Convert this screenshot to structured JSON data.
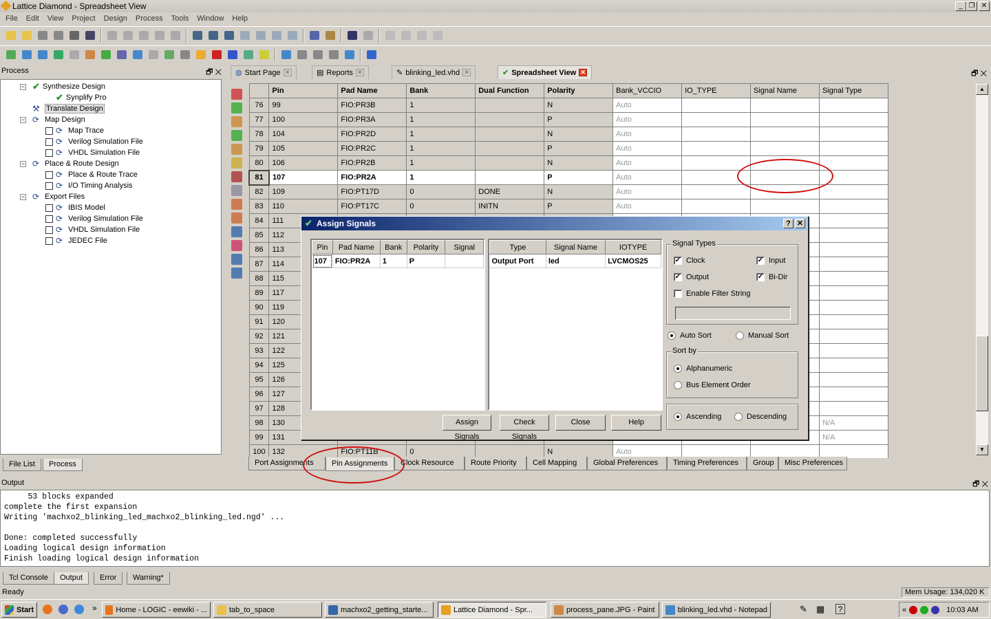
{
  "window": {
    "title": "Lattice Diamond - Spreadsheet View"
  },
  "menu": [
    "File",
    "Edit",
    "View",
    "Project",
    "Design",
    "Process",
    "Tools",
    "Window",
    "Help"
  ],
  "process_pane": {
    "title": "Process",
    "items": [
      {
        "label": "Synthesize Design",
        "level": 0,
        "icon": "check-icon",
        "expander": "minus"
      },
      {
        "label": "Synplify Pro",
        "level": 1,
        "icon": "check-icon"
      },
      {
        "label": "Translate Design",
        "level": 0,
        "icon": "hammer-icon",
        "selected": true
      },
      {
        "label": "Map Design",
        "level": 0,
        "icon": "refresh-icon",
        "expander": "minus"
      },
      {
        "label": "Map Trace",
        "level": 1,
        "icon": "refresh-icon",
        "checkbox": true
      },
      {
        "label": "Verilog Simulation File",
        "level": 1,
        "icon": "refresh-icon",
        "checkbox": true
      },
      {
        "label": "VHDL Simulation File",
        "level": 1,
        "icon": "refresh-icon",
        "checkbox": true
      },
      {
        "label": "Place & Route Design",
        "level": 0,
        "icon": "refresh-icon",
        "expander": "minus"
      },
      {
        "label": "Place & Route Trace",
        "level": 1,
        "icon": "refresh-icon",
        "checkbox": true
      },
      {
        "label": "I/O Timing Analysis",
        "level": 1,
        "icon": "refresh-icon",
        "checkbox": true
      },
      {
        "label": "Export Files",
        "level": 0,
        "icon": "refresh-icon",
        "expander": "minus"
      },
      {
        "label": "IBIS Model",
        "level": 1,
        "icon": "refresh-icon",
        "checkbox": true
      },
      {
        "label": "Verilog Simulation File",
        "level": 1,
        "icon": "refresh-icon",
        "checkbox": true
      },
      {
        "label": "VHDL Simulation File",
        "level": 1,
        "icon": "refresh-icon",
        "checkbox": true
      },
      {
        "label": "JEDEC File",
        "level": 1,
        "icon": "refresh-icon",
        "checkbox": true
      }
    ],
    "tabs": [
      "File List",
      "Process"
    ],
    "active_tab": "Process"
  },
  "editor_tabs": [
    {
      "label": "Start Page"
    },
    {
      "label": "Reports"
    },
    {
      "label": "blinking_led.vhd"
    },
    {
      "label": "Spreadsheet View",
      "active": true
    }
  ],
  "grid": {
    "columns": [
      "Pin",
      "Pad Name",
      "Bank",
      "Dual Function",
      "Polarity",
      "Bank_VCCIO",
      "IO_TYPE",
      "Signal Name",
      "Signal Type"
    ],
    "rows": [
      [
        "76",
        "99",
        "FIO:PR3B",
        "1",
        "",
        "N",
        "Auto",
        "",
        "",
        ""
      ],
      [
        "77",
        "100",
        "FIO:PR3A",
        "1",
        "",
        "P",
        "Auto",
        "",
        "",
        ""
      ],
      [
        "78",
        "104",
        "FIO:PR2D",
        "1",
        "",
        "N",
        "Auto",
        "",
        "",
        ""
      ],
      [
        "79",
        "105",
        "FIO:PR2C",
        "1",
        "",
        "P",
        "Auto",
        "",
        "",
        ""
      ],
      [
        "80",
        "106",
        "FIO:PR2B",
        "1",
        "",
        "N",
        "Auto",
        "",
        "",
        ""
      ],
      [
        "81",
        "107",
        "FIO:PR2A",
        "1",
        "",
        "P",
        "Auto",
        "",
        "",
        ""
      ],
      [
        "82",
        "109",
        "FIO:PT17D",
        "0",
        "DONE",
        "N",
        "Auto",
        "",
        "",
        ""
      ],
      [
        "83",
        "110",
        "FIO:PT17C",
        "0",
        "INITN",
        "P",
        "Auto",
        "",
        "",
        ""
      ],
      [
        "84",
        "111",
        "",
        "",
        "",
        "",
        "",
        "",
        "",
        ""
      ],
      [
        "85",
        "112",
        "",
        "",
        "",
        "",
        "",
        "",
        "",
        ""
      ],
      [
        "86",
        "113",
        "",
        "",
        "",
        "",
        "",
        "",
        "",
        ""
      ],
      [
        "87",
        "114",
        "",
        "",
        "",
        "",
        "",
        "",
        "",
        ""
      ],
      [
        "88",
        "115",
        "",
        "",
        "",
        "",
        "",
        "",
        "",
        ""
      ],
      [
        "89",
        "117",
        "",
        "",
        "",
        "",
        "",
        "",
        "",
        ""
      ],
      [
        "90",
        "119",
        "",
        "",
        "",
        "",
        "",
        "",
        "",
        ""
      ],
      [
        "91",
        "120",
        "",
        "",
        "",
        "",
        "",
        "",
        "",
        ""
      ],
      [
        "92",
        "121",
        "",
        "",
        "",
        "",
        "",
        "",
        "",
        ""
      ],
      [
        "93",
        "122",
        "",
        "",
        "",
        "",
        "",
        "",
        "",
        ""
      ],
      [
        "94",
        "125",
        "",
        "",
        "",
        "",
        "",
        "",
        "",
        ""
      ],
      [
        "95",
        "126",
        "",
        "",
        "",
        "",
        "",
        "",
        "",
        ""
      ],
      [
        "96",
        "127",
        "",
        "",
        "",
        "",
        "",
        "",
        "",
        ""
      ],
      [
        "97",
        "128",
        "",
        "",
        "",
        "",
        "",
        "",
        "",
        ""
      ],
      [
        "98",
        "130",
        "",
        "",
        "",
        "",
        "",
        "",
        "",
        "N/A"
      ],
      [
        "99",
        "131",
        "",
        "",
        "",
        "",
        "",
        "",
        "",
        "N/A"
      ],
      [
        "100",
        "132",
        "FIO:PT11B",
        "0",
        "",
        "N",
        "Auto",
        "",
        "",
        ""
      ]
    ],
    "selected_row": "81"
  },
  "bottom_tabs": [
    "Port Assignments",
    "Pin Assignments",
    "Clock Resource",
    "Route Priority",
    "Cell Mapping",
    "Global Preferences",
    "Timing Preferences",
    "Group",
    "Misc Preferences"
  ],
  "active_bottom_tab": "Pin Assignments",
  "dialog": {
    "title": "Assign Signals",
    "pin_table": {
      "columns": [
        "Pin",
        "Pad Name",
        "Bank",
        "Polarity",
        "Signal"
      ],
      "rows": [
        [
          "107",
          "FIO:PR2A",
          "1",
          "P",
          ""
        ]
      ]
    },
    "signal_table": {
      "columns": [
        "Type",
        "Signal Name",
        "IOTYPE"
      ],
      "rows": [
        [
          "Output Port",
          "led",
          "LVCMOS25"
        ]
      ]
    },
    "signal_types": {
      "label": "Signal Types",
      "clock": {
        "label": "Clock",
        "checked": true
      },
      "input": {
        "label": "Input",
        "checked": true
      },
      "output": {
        "label": "Output",
        "checked": true
      },
      "bidir": {
        "label": "Bi-Dir",
        "checked": true
      },
      "filter": {
        "label": "Enable Filter String",
        "checked": false
      },
      "filter_value": ""
    },
    "sort_mode": {
      "auto": "Auto Sort",
      "manual": "Manual Sort",
      "selected": "Auto Sort"
    },
    "sort_by": {
      "label": "Sort by",
      "alpha": "Alphanumeric",
      "bus": "Bus Element Order",
      "selected": "Alphanumeric"
    },
    "order": {
      "asc": "Ascending",
      "desc": "Descending",
      "selected": "Ascending"
    },
    "buttons": {
      "assign": "Assign Signals",
      "check": "Check Signals",
      "close": "Close",
      "help": "Help"
    }
  },
  "output": {
    "title": "Output",
    "text": "     53 blocks expanded\ncomplete the first expansion\nWriting 'machxo2_blinking_led_machxo2_blinking_led.ngd' ...\n\nDone: completed successfully\nLoading logical design information\nFinish loading logical design information",
    "tabs": [
      "Tcl Console",
      "Output",
      "Error",
      "Warning*"
    ],
    "active_tab": "Output"
  },
  "status": {
    "text": "Ready",
    "mem": "Mem Usage: 134,020 K"
  },
  "taskbar": {
    "start": "Start",
    "tasks": [
      "Home - LOGIC - eewiki - ...",
      "tab_to_space",
      "machxo2_getting_starte...",
      "Lattice Diamond - Spr...",
      "process_pane.JPG - Paint",
      "blinking_led.vhd - Notepad"
    ],
    "active_task": "Lattice Diamond - Spr...",
    "clock": "10:03 AM"
  },
  "colors": {
    "annotation": "#d01010",
    "dialog_title": "#0a246a"
  }
}
